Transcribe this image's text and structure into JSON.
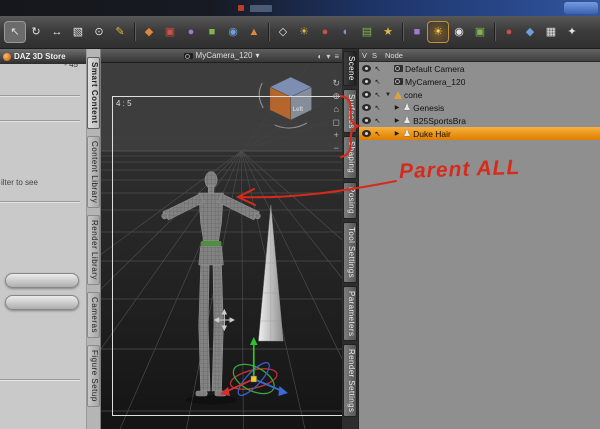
{
  "toolbar": {
    "icons": [
      {
        "name": "pointer-tool",
        "glyph": "↖"
      },
      {
        "name": "rotate-tool",
        "glyph": "↻"
      },
      {
        "name": "translate-tool",
        "glyph": "↔"
      },
      {
        "name": "scale-tool",
        "glyph": "▧"
      },
      {
        "name": "universal-tool",
        "glyph": "⊙"
      },
      {
        "name": "node-editor-tool",
        "glyph": "✎"
      },
      {
        "name": "surface-tool",
        "glyph": "◆"
      },
      {
        "name": "spot-render-tool",
        "glyph": "▣"
      },
      {
        "name": "powerpose-tool",
        "glyph": "●"
      },
      {
        "name": "primitive-create",
        "glyph": "■"
      },
      {
        "name": "magnet-tool",
        "glyph": "◉"
      },
      {
        "name": "figure-create",
        "glyph": "▲"
      },
      {
        "name": "wardrobe-tool",
        "glyph": "◇"
      },
      {
        "name": "environment-tool",
        "glyph": "☀"
      },
      {
        "name": "material-tool",
        "glyph": "●"
      },
      {
        "name": "sphere-view-tool",
        "glyph": "◐"
      },
      {
        "name": "layers-tool",
        "glyph": "▤"
      },
      {
        "name": "favorites-tool",
        "glyph": "★"
      },
      {
        "name": "grid-tool",
        "glyph": "■"
      },
      {
        "name": "light-toggle",
        "glyph": "☀"
      },
      {
        "name": "camera-tool",
        "glyph": "◉"
      },
      {
        "name": "capture-tool",
        "glyph": "▣"
      },
      {
        "name": "record-tool",
        "glyph": "●"
      },
      {
        "name": "aux-view-tool",
        "glyph": "◆"
      },
      {
        "name": "layout-tool",
        "glyph": "▦"
      },
      {
        "name": "settings-tool",
        "glyph": "✦"
      }
    ]
  },
  "left_panel": {
    "store_label": "DAZ 3D Store",
    "fragment_top": "- 45",
    "fragment_filter": "ilter to see",
    "tabs": [
      "Smart Content",
      "Content Library",
      "Render Library",
      "Cameras",
      "Figure Setup"
    ]
  },
  "viewport": {
    "camera_label": "MyCamera_120",
    "dropdown_glyph": "▾",
    "aspect_label": "4 : 5",
    "header_icons": {
      "sphere": "◐",
      "dropdown": "▾",
      "menu": "≡"
    },
    "controls": [
      "↻",
      "⊕",
      "⌂",
      "◻",
      "+",
      "−"
    ],
    "cube_face_label": "Left"
  },
  "right_tabs": [
    "Scene",
    "Surfaces",
    "Shaping",
    "Posing",
    "Tool Settings",
    "Parameters",
    "Render Settings"
  ],
  "scene_panel": {
    "columns": {
      "v": "V",
      "s": "S",
      "node": "Node"
    },
    "cursor_glyph": "↖",
    "items": [
      {
        "name": "Default Camera",
        "expand": ""
      },
      {
        "name": "MyCamera_120",
        "expand": ""
      },
      {
        "name": "cone",
        "expand": "▼"
      },
      {
        "name": "Genesis",
        "expand": "▶"
      },
      {
        "name": "B25SportsBra",
        "expand": "▶"
      },
      {
        "name": "Duke Hair",
        "expand": "▶"
      }
    ]
  },
  "annotations": {
    "label": "Parent ALL"
  },
  "colors": {
    "selection_orange": "#ef8f1a",
    "annotation_red": "#d62b1c"
  }
}
